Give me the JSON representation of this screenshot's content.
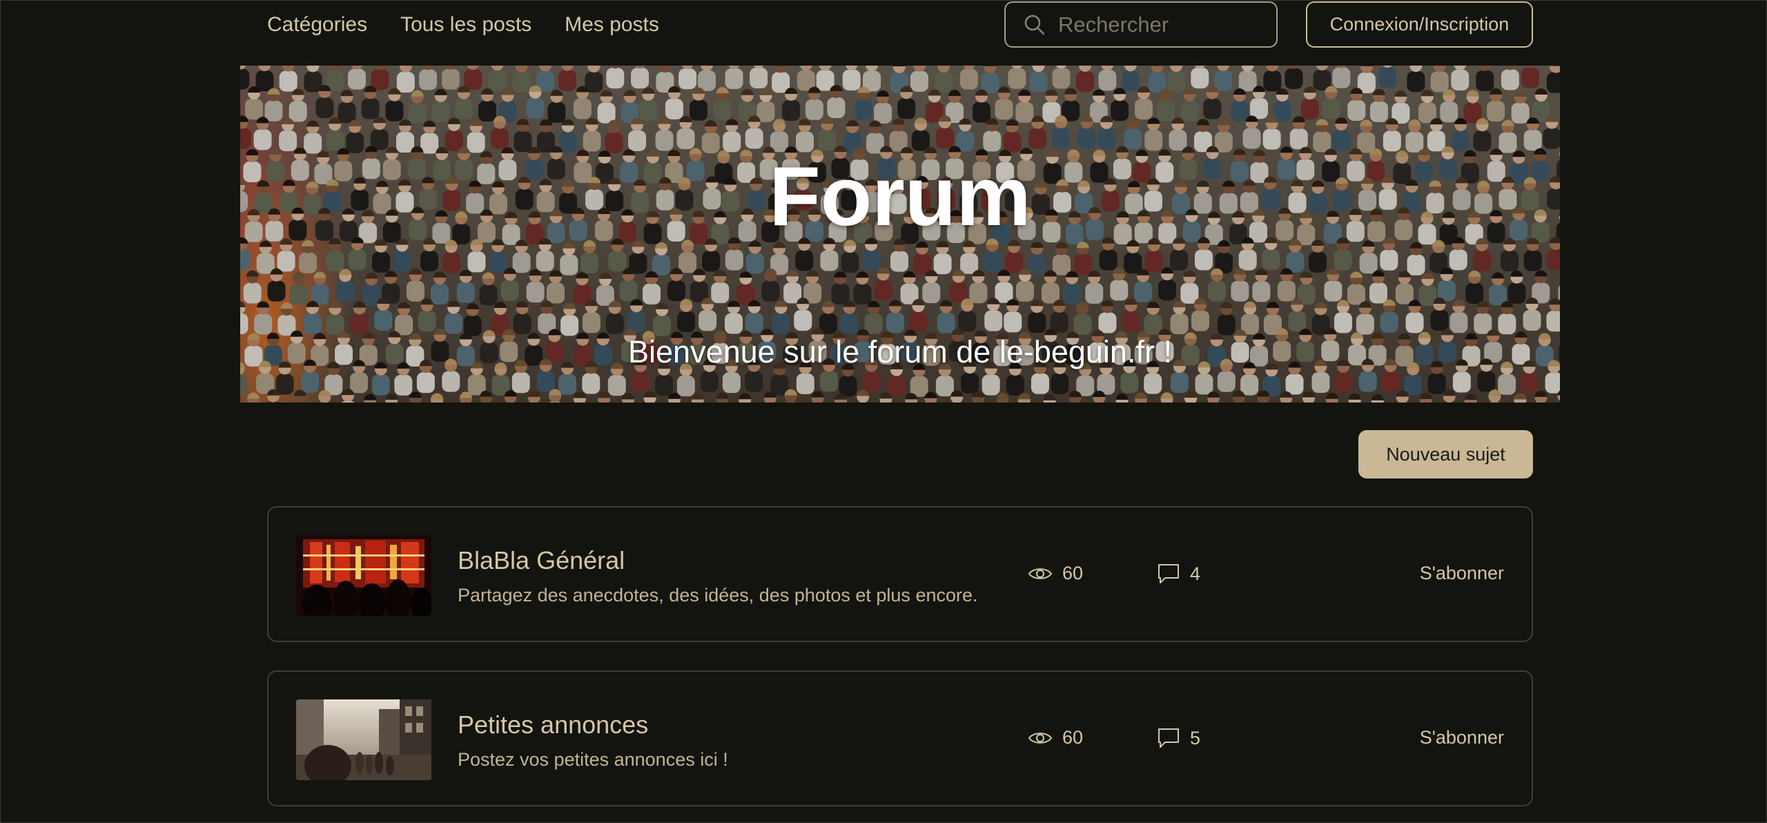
{
  "nav": {
    "items": [
      "Catégories",
      "Tous les posts",
      "Mes posts"
    ]
  },
  "search": {
    "placeholder": "Rechercher",
    "icon": "search-icon"
  },
  "auth": {
    "login_label": "Connexion/Inscription"
  },
  "hero": {
    "title": "Forum",
    "subtitle": "Bienvenue sur le forum de le-beguin.fr !"
  },
  "actions": {
    "new_topic_label": "Nouveau sujet"
  },
  "categories": [
    {
      "title": "BlaBla Général",
      "description": "Partagez des anecdotes, des idées, des photos et plus encore.",
      "views": "60",
      "comments": "4",
      "subscribe_label": "S'abonner"
    },
    {
      "title": "Petites annonces",
      "description": "Postez vos petites annonces ici !",
      "views": "60",
      "comments": "5",
      "subscribe_label": "S'abonner"
    }
  ],
  "colors": {
    "background": "#13140f",
    "text": "#d6c7a8",
    "accent_button": "#c9b795",
    "card_border": "#3d3e37"
  }
}
